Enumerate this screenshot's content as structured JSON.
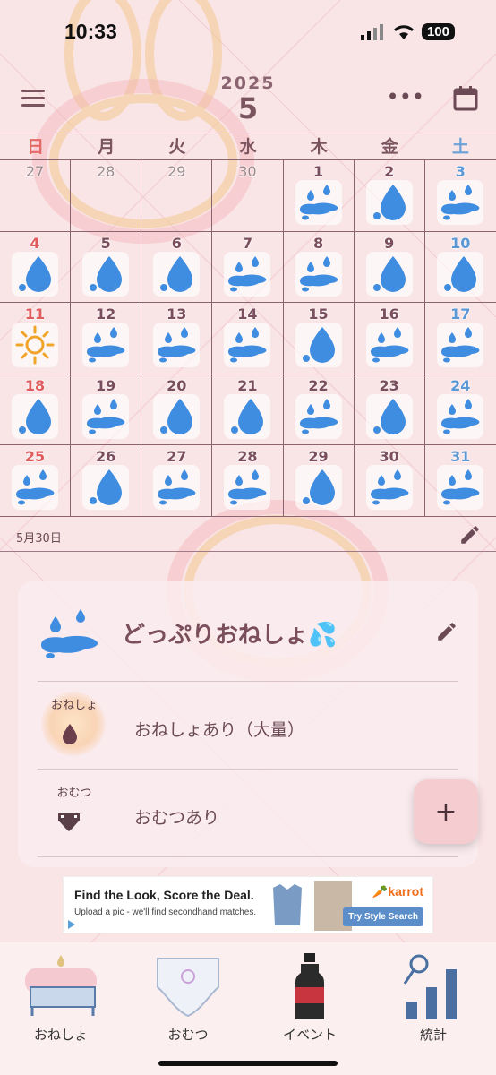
{
  "status_bar": {
    "time": "10:33",
    "battery": "100"
  },
  "header": {
    "year": "2025",
    "month": "5"
  },
  "calendar": {
    "weekdays": [
      "日",
      "月",
      "火",
      "水",
      "木",
      "金",
      "土"
    ],
    "days": [
      {
        "day": "27",
        "icon": ""
      },
      {
        "day": "28",
        "icon": ""
      },
      {
        "day": "29",
        "icon": ""
      },
      {
        "day": "30",
        "icon": ""
      },
      {
        "day": "1",
        "icon": "puddle-icon"
      },
      {
        "day": "2",
        "icon": "drop-icon"
      },
      {
        "day": "3",
        "icon": "puddle-icon"
      },
      {
        "day": "4",
        "icon": "drop-icon"
      },
      {
        "day": "5",
        "icon": "drop-icon"
      },
      {
        "day": "6",
        "icon": "drop-icon"
      },
      {
        "day": "7",
        "icon": "puddle-icon"
      },
      {
        "day": "8",
        "icon": "puddle-icon"
      },
      {
        "day": "9",
        "icon": "drop-icon"
      },
      {
        "day": "10",
        "icon": "drop-icon"
      },
      {
        "day": "11",
        "icon": "sun-icon"
      },
      {
        "day": "12",
        "icon": "puddle-icon"
      },
      {
        "day": "13",
        "icon": "puddle-icon"
      },
      {
        "day": "14",
        "icon": "puddle-icon"
      },
      {
        "day": "15",
        "icon": "drop-icon"
      },
      {
        "day": "16",
        "icon": "puddle-icon"
      },
      {
        "day": "17",
        "icon": "puddle-icon"
      },
      {
        "day": "18",
        "icon": "drop-icon"
      },
      {
        "day": "19",
        "icon": "puddle-icon"
      },
      {
        "day": "20",
        "icon": "drop-icon"
      },
      {
        "day": "21",
        "icon": "drop-icon"
      },
      {
        "day": "22",
        "icon": "puddle-icon"
      },
      {
        "day": "23",
        "icon": "drop-icon"
      },
      {
        "day": "24",
        "icon": "puddle-icon"
      },
      {
        "day": "25",
        "icon": "puddle-icon"
      },
      {
        "day": "26",
        "icon": "drop-icon"
      },
      {
        "day": "27",
        "icon": "puddle-icon"
      },
      {
        "day": "28",
        "icon": "puddle-icon"
      },
      {
        "day": "29",
        "icon": "drop-icon"
      },
      {
        "day": "30",
        "icon": "puddle-icon"
      },
      {
        "day": "31",
        "icon": "puddle-icon"
      }
    ]
  },
  "selected": {
    "date": "5月30日"
  },
  "detail": {
    "summary_label": "どっぷりおねしょ💦",
    "rows": [
      {
        "badge": "おねしょ",
        "text": "おねしょあり（大量）"
      },
      {
        "badge": "おむつ",
        "text": "おむつあり"
      }
    ]
  },
  "ad": {
    "title": "Find the Look, Score the Deal.",
    "subtitle": "Upload a pic - we'll find secondhand matches.",
    "brand": "karrot",
    "cta": "Try Style Search"
  },
  "nav": {
    "items": [
      {
        "label": "おねしょ"
      },
      {
        "label": "おむつ"
      },
      {
        "label": "イベント"
      },
      {
        "label": "統計"
      }
    ]
  },
  "colors": {
    "background": "#f9e4e6",
    "sunday": "#e05b5b",
    "saturday": "#5a98d6",
    "drop": "#3f8de0",
    "accent_text": "#7a4e5c"
  }
}
